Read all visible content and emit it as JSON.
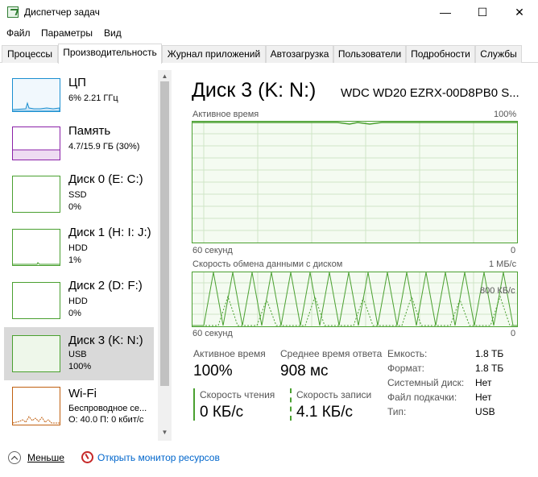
{
  "window": {
    "title": "Диспетчер задач",
    "min_glyph": "—",
    "max_glyph": "☐",
    "close_glyph": "✕"
  },
  "menu": [
    "Файл",
    "Параметры",
    "Вид"
  ],
  "tabs": [
    "Процессы",
    "Производительность",
    "Журнал приложений",
    "Автозагрузка",
    "Пользователи",
    "Подробности",
    "Службы"
  ],
  "active_tab": "Производительность",
  "sidebar": [
    {
      "name": "ЦП",
      "line1": "6% 2.21 ГГц",
      "line2": "",
      "line3": "",
      "color": "#1a8fd0",
      "icon": "cpu-graph"
    },
    {
      "name": "Память",
      "line1": "4.7/15.9 ГБ (30%)",
      "line2": "",
      "line3": "",
      "color": "#8b21a8",
      "icon": "memory-graph"
    },
    {
      "name": "Диск 0 (E: C:)",
      "line1": "SSD",
      "line2": "0%",
      "line3": "",
      "color": "#4aa030",
      "icon": "disk-graph"
    },
    {
      "name": "Диск 1 (H: I: J:)",
      "line1": "HDD",
      "line2": "1%",
      "line3": "",
      "color": "#4aa030",
      "icon": "disk-graph"
    },
    {
      "name": "Диск 2 (D: F:)",
      "line1": "HDD",
      "line2": "0%",
      "line3": "",
      "color": "#4aa030",
      "icon": "disk-graph"
    },
    {
      "name": "Диск 3 (K: N:)",
      "line1": "USB",
      "line2": "100%",
      "line3": "",
      "color": "#4aa030",
      "icon": "disk-graph",
      "selected": true
    },
    {
      "name": "Wi-Fi",
      "line1": "Беспроводное се...",
      "line2": "О: 40.0  П: 0 кбит/с",
      "line3": "",
      "color": "#c06010",
      "icon": "wifi-graph"
    }
  ],
  "main": {
    "title": "Диск 3 (K: N:)",
    "model": "WDC WD20 EZRX-00D8PB0 S...",
    "graph1": {
      "label": "Активное время",
      "max": "100%",
      "time_label": "60 секунд",
      "zero": "0",
      "value_percent": 100
    },
    "graph2": {
      "label": "Скорость обмена данными с диском",
      "max": "1 МБ/с",
      "mid": "800 КБ/с",
      "time_label": "60 секунд",
      "zero": "0"
    },
    "stats": {
      "active_time_label": "Активное время",
      "active_time_value": "100%",
      "avg_response_label": "Среднее время ответа",
      "avg_response_value": "908 мс",
      "read_label": "Скорость чтения",
      "read_value": "0 КБ/с",
      "write_label": "Скорость записи",
      "write_value": "4.1 КБ/с"
    },
    "properties": [
      {
        "key": "Емкость:",
        "value": "1.8 ТБ"
      },
      {
        "key": "Формат:",
        "value": "1.8 ТБ"
      },
      {
        "key": "Системный диск:",
        "value": "Нет"
      },
      {
        "key": "Файл подкачки:",
        "value": "Нет"
      },
      {
        "key": "Тип:",
        "value": "USB"
      }
    ]
  },
  "footer": {
    "less_label": "Меньше",
    "monitor_label": "Открыть монитор ресурсов"
  },
  "colors": {
    "disk_green": "#4aa030",
    "graph_fill": "#f4fbf1",
    "selected_bg": "#d9d9d9"
  }
}
